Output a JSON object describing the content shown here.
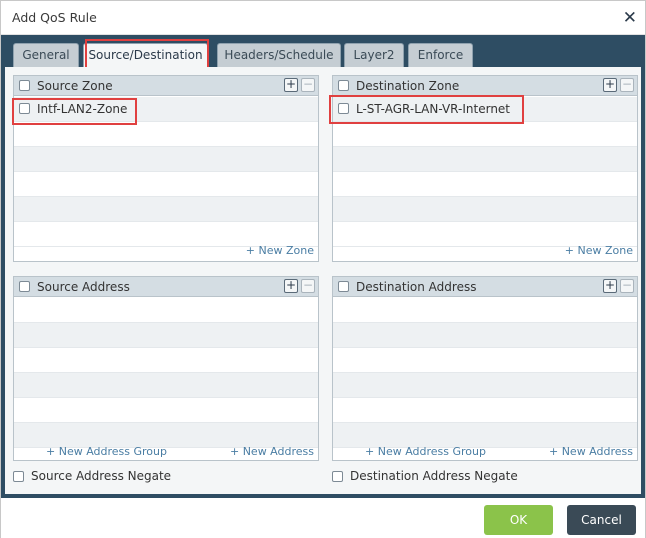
{
  "dialog": {
    "title": "Add QoS Rule"
  },
  "tabs": [
    {
      "label": "General"
    },
    {
      "label": "Source/Destination"
    },
    {
      "label": "Headers/Schedule"
    },
    {
      "label": "Layer2"
    },
    {
      "label": "Enforce"
    }
  ],
  "active_tab": "Source/Destination",
  "source_zone": {
    "header": "Source Zone",
    "rows": [
      "Intf-LAN2-Zone"
    ],
    "new_link": "+ New Zone"
  },
  "destination_zone": {
    "header": "Destination Zone",
    "rows": [
      "L-ST-AGR-LAN-VR-Internet"
    ],
    "new_link": "+ New Zone"
  },
  "source_address": {
    "header": "Source Address",
    "new_group_link": "+ New Address Group",
    "new_link": "+ New Address",
    "negate_label": "Source Address Negate"
  },
  "destination_address": {
    "header": "Destination Address",
    "new_group_link": "+ New Address Group",
    "new_link": "+ New Address",
    "negate_label": "Destination Address Negate"
  },
  "buttons": {
    "ok": "OK",
    "cancel": "Cancel"
  },
  "colors": {
    "panel_bg": "#2e4d63",
    "ok_button": "#8bc34a",
    "cancel_button": "#3a4a56",
    "highlight": "#e04040",
    "link": "#4a7da3"
  },
  "icons": {
    "close": "close-icon",
    "add": "plus-icon",
    "remove": "minus-icon"
  }
}
